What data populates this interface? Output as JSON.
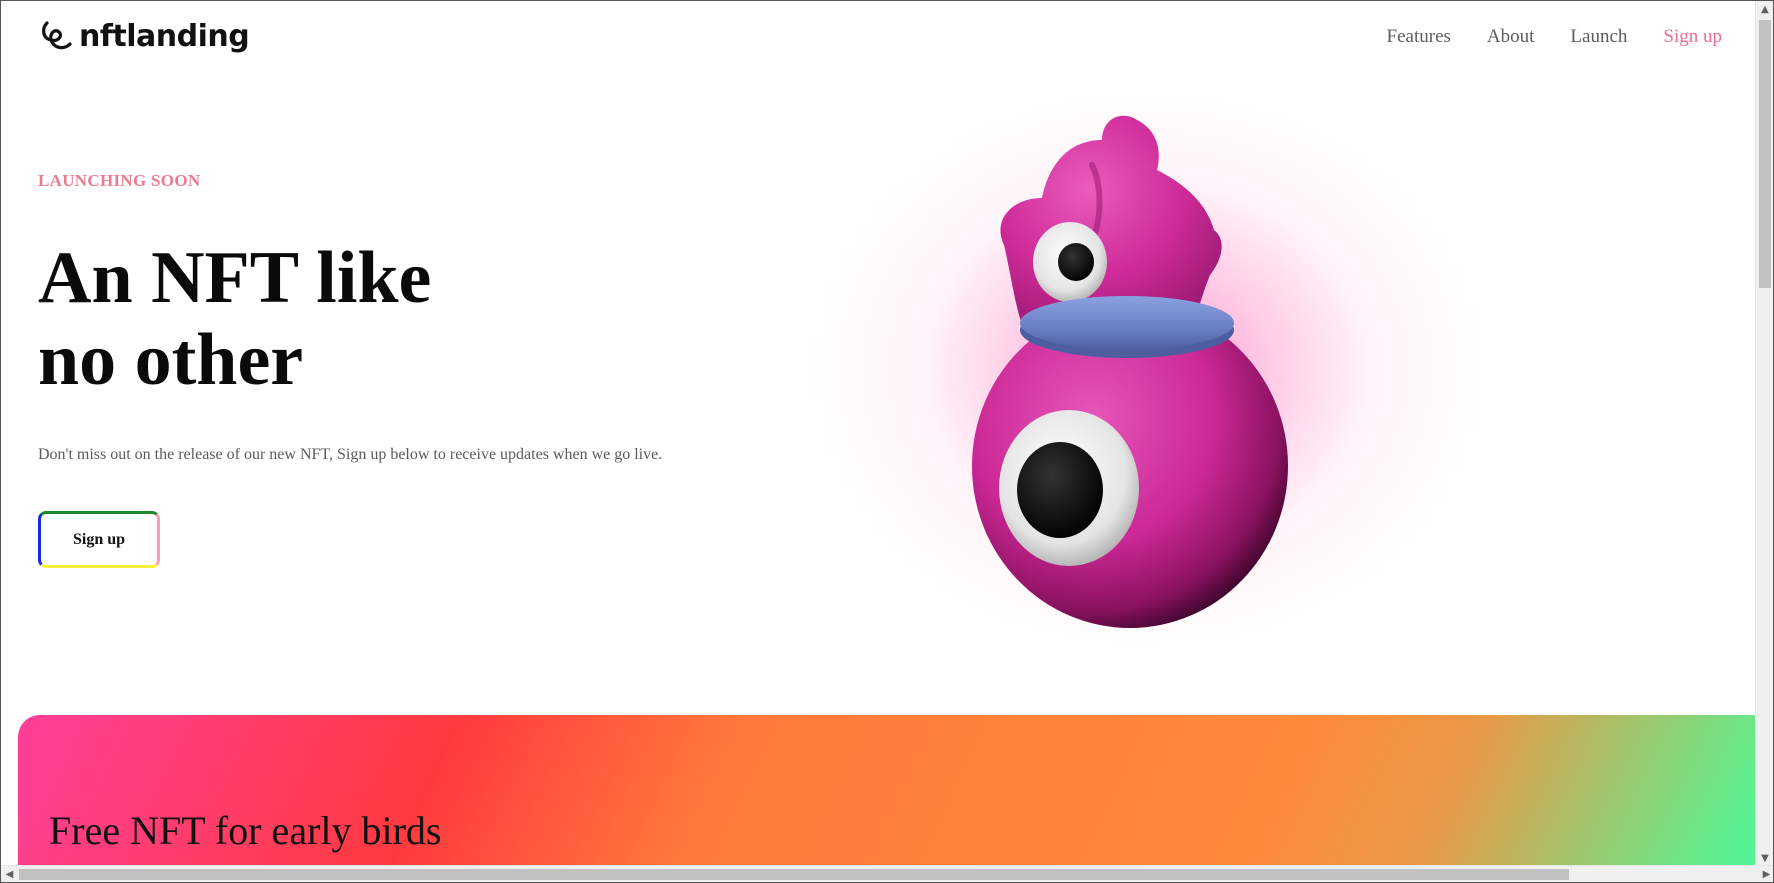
{
  "header": {
    "logo_text": "nftlanding",
    "nav": [
      {
        "label": "Features"
      },
      {
        "label": "About"
      },
      {
        "label": "Launch"
      },
      {
        "label": "Sign up"
      }
    ]
  },
  "hero": {
    "eyebrow": "LAUNCHING SOON",
    "headline_line1": "An NFT like",
    "headline_line2": "no other",
    "lead": "Don't miss out on the release of our new NFT, Sign up below to receive updates when we go live.",
    "cta_label": "Sign up"
  },
  "banner": {
    "title": "Free NFT for early birds"
  },
  "icons": {
    "logo": "swirl-logo-icon",
    "mascot": "pink-one-eyed-mascot-image"
  },
  "colors": {
    "accent_pink": "#ee6d90",
    "mascot_pink": "#d02c9b",
    "gradient_start": "#ff3f9a",
    "gradient_mid": "#ff7a3a",
    "gradient_end": "#4cf59c"
  }
}
